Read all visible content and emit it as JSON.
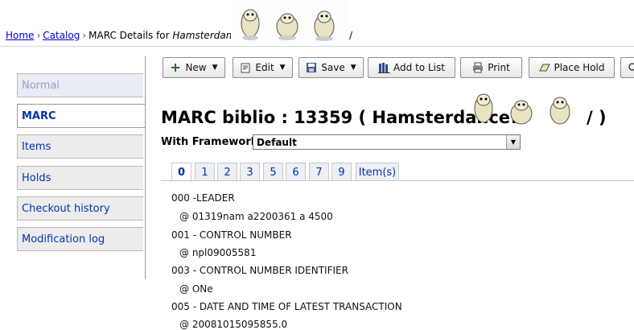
{
  "breadcrumb": {
    "home": "Home",
    "catalog": "Catalog",
    "sep": "›",
    "current_prefix": "MARC Details for",
    "current_title": "Hamsterdance!",
    "trail_end": "/"
  },
  "toolbar": {
    "new_label": "New",
    "edit_label": "Edit",
    "save_label": "Save",
    "add_to_list_label": "Add to List",
    "print_label": "Print",
    "place_hold_label": "Place Hold"
  },
  "sidebar": {
    "items": [
      {
        "label": "Normal"
      },
      {
        "label": "MARC"
      },
      {
        "label": "Items"
      },
      {
        "label": "Holds"
      },
      {
        "label": "Checkout history"
      },
      {
        "label": "Modification log"
      }
    ]
  },
  "main": {
    "title": "MARC biblio : 13359 ( Hamsterdance!",
    "title_end": "/ )",
    "framework_label": "With Framework :",
    "framework_value": "Default",
    "tabs": [
      "0",
      "1",
      "2",
      "3",
      "5",
      "6",
      "7",
      "9",
      "Item(s)"
    ],
    "active_tab": "0"
  },
  "marc": [
    {
      "tag": "000 -LEADER",
      "sub": "@ 01319nam a2200361 a 4500"
    },
    {
      "tag": "001 - CONTROL NUMBER",
      "sub": "@ npl09005581"
    },
    {
      "tag": "003 - CONTROL NUMBER IDENTIFIER",
      "sub": "@ ONe"
    },
    {
      "tag": "005 - DATE AND TIME OF LATEST TRANSACTION",
      "sub": "@ 20081015095855.0"
    }
  ],
  "icons": {
    "hamster": "hamster-icon",
    "new": "plus-icon",
    "edit": "edit-icon",
    "save": "save-icon",
    "list": "books-icon",
    "print": "printer-icon",
    "hold": "hold-icon"
  }
}
